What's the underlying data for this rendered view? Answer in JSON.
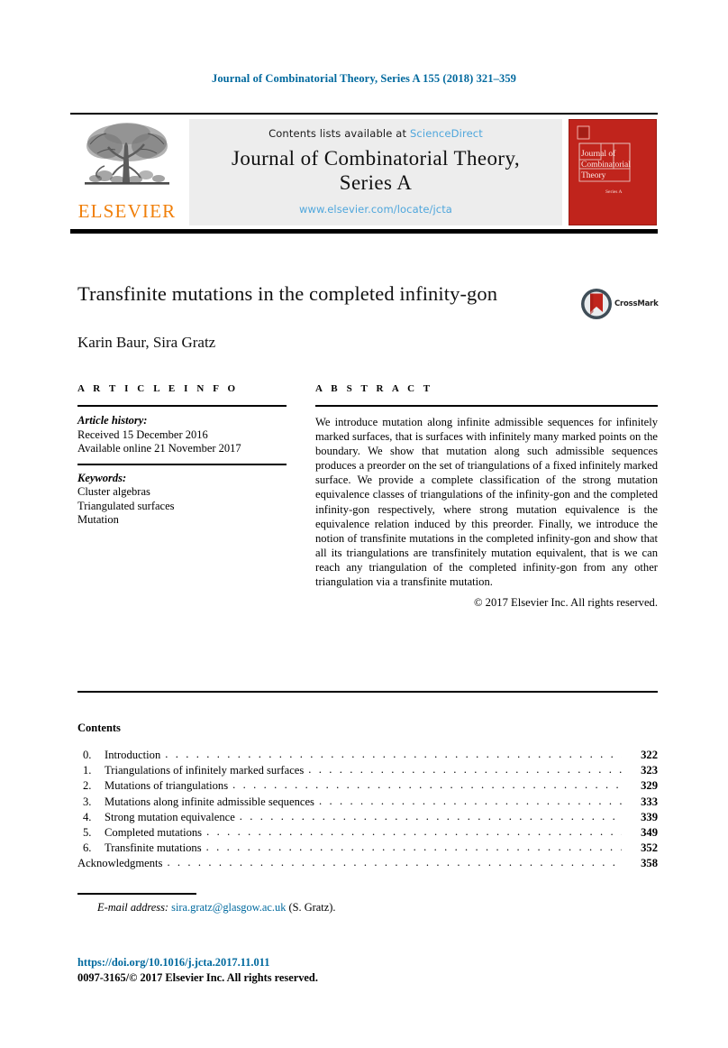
{
  "running_head": "Journal of Combinatorial Theory, Series A 155 (2018) 321–359",
  "masthead": {
    "contents_prefix": "Contents lists available at ",
    "sciencedirect": "ScienceDirect",
    "journal_title_line1": "Journal of Combinatorial Theory,",
    "journal_title_line2": "Series A",
    "journal_url": "www.elsevier.com/locate/jcta",
    "publisher_name": "ELSEVIER",
    "cover_title_line1": "Journal of",
    "cover_title_line2": "Combinatorial",
    "cover_title_line3": "Theory",
    "cover_subtitle": "Series A"
  },
  "article": {
    "title": "Transfinite mutations in the completed infinity-gon",
    "authors": "Karin Baur, Sira Gratz",
    "crossmark_label": "CrossMark"
  },
  "article_info": {
    "heading": "A R T I C L E   I N F O",
    "history_label": "Article history:",
    "history_lines": [
      "Received 15 December 2016",
      "Available online 21 November 2017"
    ],
    "keywords_label": "Keywords:",
    "keywords": [
      "Cluster algebras",
      "Triangulated surfaces",
      "Mutation"
    ]
  },
  "abstract": {
    "heading": "A B S T R A C T",
    "text": "We introduce mutation along infinite admissible sequences for infinitely marked surfaces, that is surfaces with infinitely many marked points on the boundary. We show that mutation along such admissible sequences produces a preorder on the set of triangulations of a fixed infinitely marked surface. We provide a complete classification of the strong mutation equivalence classes of triangulations of the infinity-gon and the completed infinity-gon respectively, where strong mutation equivalence is the equivalence relation induced by this preorder. Finally, we introduce the notion of transfinite mutations in the completed infinity-gon and show that all its triangulations are transfinitely mutation equivalent, that is we can reach any triangulation of the completed infinity-gon from any other triangulation via a transfinite mutation.",
    "copyright": "© 2017 Elsevier Inc. All rights reserved."
  },
  "contents": {
    "heading": "Contents",
    "dots": ". . . . . . . . . . . . . . . . . . . . . . . . . . . . . . . . . . . . . . . . . . . . . . . . . . . . . . . . . . . . . . . . . . . . . . . . . . . . . . . . . . . . . . . . . . . . . . . . . . . . . .",
    "entries": [
      {
        "num": "0.",
        "label": "Introduction",
        "page": "322"
      },
      {
        "num": "1.",
        "label": "Triangulations of infinitely marked surfaces",
        "page": "323"
      },
      {
        "num": "2.",
        "label": "Mutations of triangulations",
        "page": "329"
      },
      {
        "num": "3.",
        "label": "Mutations along infinite admissible sequences",
        "page": "333"
      },
      {
        "num": "4.",
        "label": "Strong mutation equivalence",
        "page": "339"
      },
      {
        "num": "5.",
        "label": "Completed mutations",
        "page": "349"
      },
      {
        "num": "6.",
        "label": "Transfinite mutations",
        "page": "352"
      },
      {
        "num": "",
        "label": "Acknowledgments",
        "page": "358"
      }
    ]
  },
  "footer": {
    "email_label": "E-mail address:",
    "email_address": "sira.gratz@glasgow.ac.uk",
    "email_suffix": "(S. Gratz).",
    "doi": "https://doi.org/10.1016/j.jcta.2017.11.011",
    "issn_copyright": "0097-3165/© 2017 Elsevier Inc. All rights reserved."
  },
  "colors": {
    "link_blue": "#00699E",
    "light_blue": "#4EA6DC",
    "elsevier_orange": "#F07F09",
    "cover_red": "#C0241C"
  }
}
